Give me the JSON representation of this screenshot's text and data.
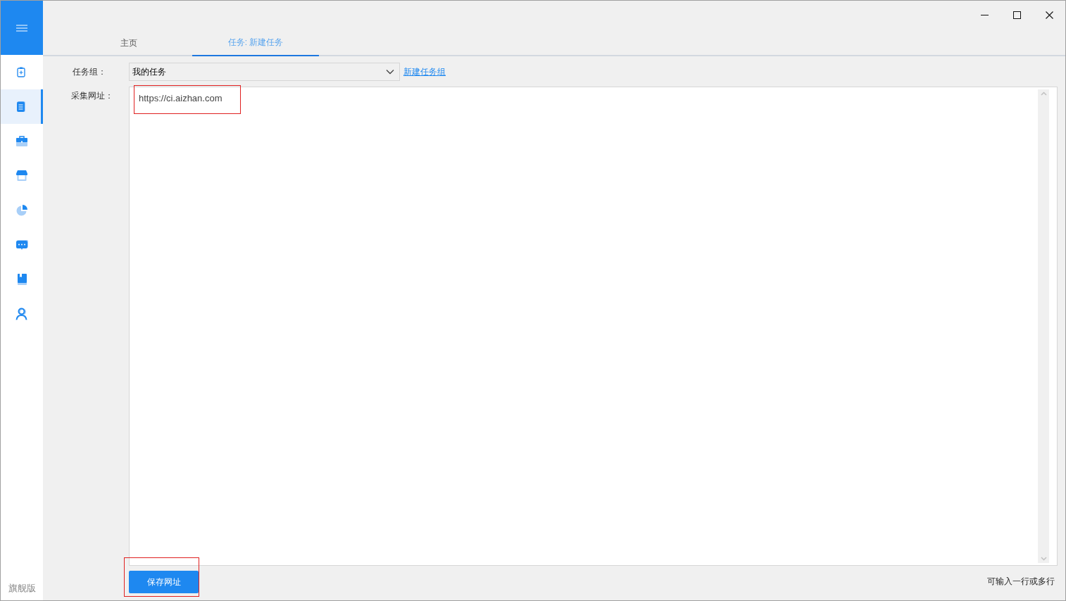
{
  "sidebar": {
    "items": [
      {
        "kind": "clipboard-plus",
        "selected": false
      },
      {
        "kind": "document",
        "selected": true
      },
      {
        "kind": "briefcase",
        "selected": false
      },
      {
        "kind": "store",
        "selected": false
      },
      {
        "kind": "pie",
        "selected": false
      },
      {
        "kind": "chat",
        "selected": false
      },
      {
        "kind": "book",
        "selected": false
      },
      {
        "kind": "user",
        "selected": false
      }
    ],
    "edition": "旗舰版"
  },
  "tabs": [
    {
      "label": "主页",
      "selected": false
    },
    {
      "label": "任务: 新建任务",
      "selected": true
    }
  ],
  "form": {
    "group_label": "任务组：",
    "group_value": "我的任务",
    "new_group_link": "新建任务组",
    "url_label": "采集网址：",
    "url_value": "https://ci.aizhan.com",
    "url_highlighted": true,
    "save_button": "保存网址",
    "save_highlighted": true,
    "hint": "可输入一行或多行"
  }
}
